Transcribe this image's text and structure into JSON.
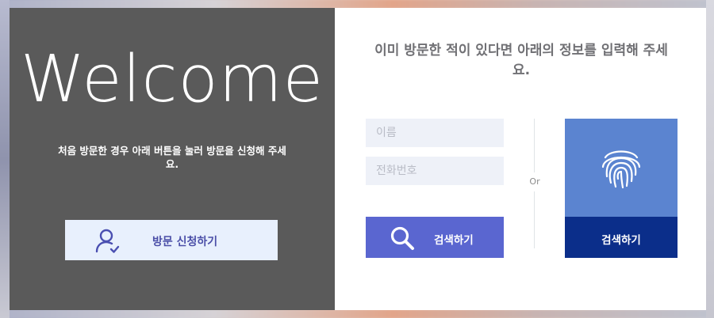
{
  "left": {
    "welcome": "Welcome",
    "description": "처음 방문한 경우 아래 버튼을 눌러 방문을 신청해 주세요.",
    "visit_button": {
      "label": "방문 신청하기",
      "icon": "user-check-icon"
    }
  },
  "right": {
    "heading": "이미 방문한 적이 있다면 아래의 정보를 입력해 주세요.",
    "name_placeholder": "이름",
    "phone_placeholder": "전화번호",
    "search_button": {
      "label": "검색하기",
      "icon": "search-icon"
    },
    "or_text": "Or",
    "fingerprint": {
      "icon": "fingerprint-icon",
      "label": "검색하기"
    }
  },
  "colors": {
    "left_panel_bg": "#5a5a5a",
    "visit_button_bg": "#e8f0fd",
    "search_button_bg": "#5a66d0",
    "fingerprint_panel_bg": "#5b84d0",
    "fingerprint_button_bg": "#0b2e8a"
  }
}
